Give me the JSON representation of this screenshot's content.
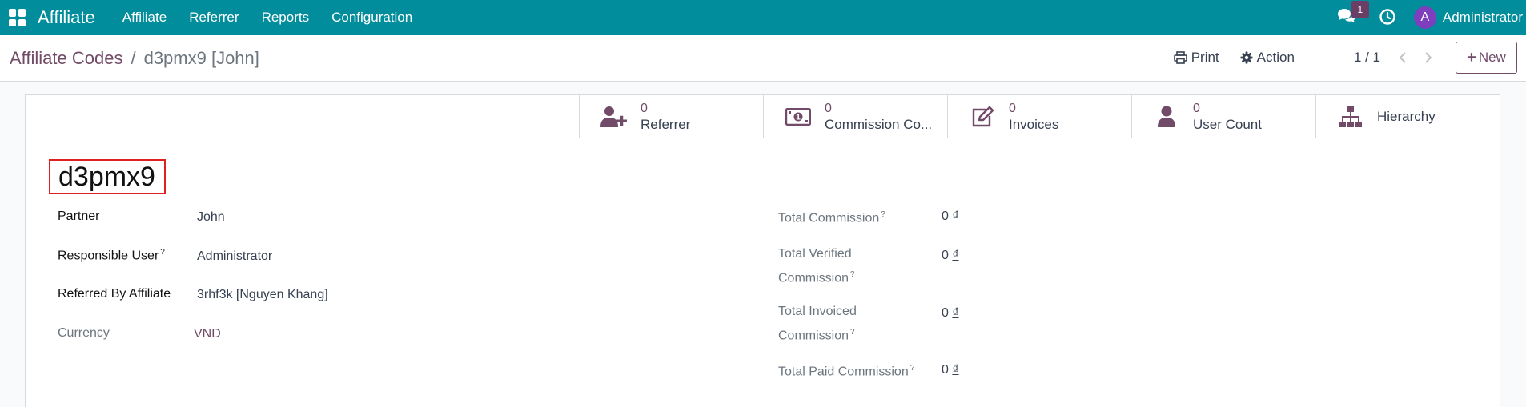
{
  "navbar": {
    "brand": "Affiliate",
    "menu": [
      "Affiliate",
      "Referrer",
      "Reports",
      "Configuration"
    ],
    "chat_count": "1",
    "user_initial": "A",
    "user_name": "Administrator",
    "bg_color": "#018d9b"
  },
  "breadcrumb": {
    "parent": "Affiliate Codes",
    "separator": "/",
    "current": "d3pmx9 [John]"
  },
  "toolbar": {
    "print_label": "Print",
    "action_label": "Action",
    "pager": "1 / 1",
    "new_label": "New"
  },
  "stat_buttons": [
    {
      "icon": "user-plus-icon",
      "value": "0",
      "label": "Referrer"
    },
    {
      "icon": "money-bill-icon",
      "value": "0",
      "label": "Commission Co..."
    },
    {
      "icon": "edit-icon",
      "value": "0",
      "label": "Invoices"
    },
    {
      "icon": "user-icon",
      "value": "0",
      "label": "User Count"
    },
    {
      "icon": "sitemap-icon",
      "value": "",
      "label": "Hierarchy"
    }
  ],
  "record": {
    "title": "d3pmx9",
    "left_fields": [
      {
        "label": "Partner",
        "value": "John",
        "help": ""
      },
      {
        "label": "Responsible User",
        "value": "Administrator",
        "help": "?"
      },
      {
        "label": "Referred By Affiliate",
        "value": "3rhf3k [Nguyen Khang]",
        "help": ""
      },
      {
        "label": "Currency",
        "value": "VND",
        "help": ""
      }
    ],
    "right_fields": [
      {
        "label": "Total Commission",
        "value": "0",
        "currency": "₫",
        "help": "?"
      },
      {
        "label": "Total Verified Commission",
        "value": "0",
        "currency": "₫",
        "help": "?"
      },
      {
        "label": "Total Invoiced Commission",
        "value": "0",
        "currency": "₫",
        "help": "?"
      },
      {
        "label": "Total Paid Commission",
        "value": "0",
        "currency": "₫",
        "help": "?"
      }
    ]
  }
}
